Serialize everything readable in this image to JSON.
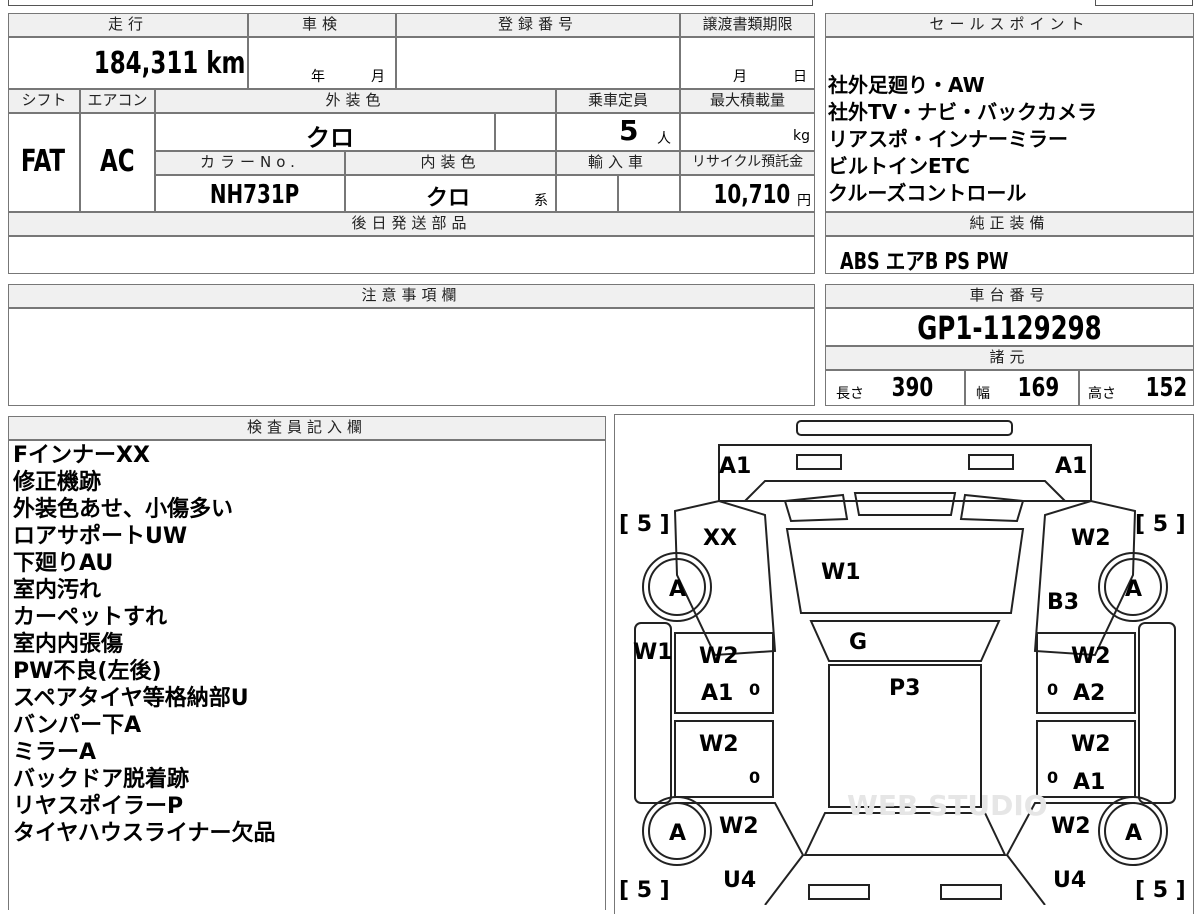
{
  "top": {
    "mileage_header": "走行",
    "mileage_value": "184,311 km",
    "shaken_header": "車検",
    "shaken_year_unit": "年",
    "shaken_month_unit": "月",
    "reg_header": "登録番号",
    "transfer_header": "譲渡書類期限",
    "transfer_month_unit": "月",
    "transfer_day_unit": "日",
    "shift_header": "シフト",
    "shift_value": "FAT",
    "ac_header": "エアコン",
    "ac_value": "AC",
    "ext_color_header": "外装色",
    "ext_color_value": "クロ",
    "capacity_header": "乗車定員",
    "capacity_value": "5",
    "capacity_unit": "人",
    "maxload_header": "最大積載量",
    "maxload_unit": "kg",
    "color_no_header": "カラーNo.",
    "color_no_value": "NH731P",
    "int_color_header": "内装色",
    "int_color_value": "クロ",
    "int_color_suffix": "系",
    "import_header": "輸入車",
    "recycle_header": "リサイクル預託金",
    "recycle_value": "10,710",
    "recycle_unit": "円",
    "later_parts_header": "後日発送部品"
  },
  "selling_points": {
    "header": "セールスポイント",
    "lines": [
      "社外足廻り・AW",
      "社外TV・ナビ・バックカメラ",
      "リアスポ・インナーミラー",
      "ビルトインETC",
      "クルーズコントロール"
    ]
  },
  "genuine_equipment": {
    "header": "純正装備",
    "value": "ABS エアB PS PW"
  },
  "notes": {
    "header": "注意事項欄"
  },
  "chassis": {
    "header": "車台番号",
    "value": "GP1-1129298",
    "spec_header": "諸元",
    "length_label": "長さ",
    "length_value": "390",
    "width_label": "幅",
    "width_value": "169",
    "height_label": "高さ",
    "height_value": "152"
  },
  "inspector": {
    "header": "検査員記入欄",
    "lines": [
      "FインナーXX",
      "修正機跡",
      "外装色あせ、小傷多い",
      "ロアサポートUW",
      "下廻りAU",
      "室内汚れ",
      "カーペットすれ",
      "室内内張傷",
      "PW不良(左後)",
      "スペアタイヤ等格納部U",
      "バンパー下A",
      "ミラーA",
      "バックドア脱着跡",
      "リヤスポイラーP",
      "タイヤハウスライナー欠品"
    ]
  },
  "diagram": {
    "marks": [
      "A1",
      "A1",
      "XX",
      "W1",
      "W2",
      "B3",
      "W1",
      "G",
      "W2",
      "W2",
      "A1",
      "P3",
      "A2",
      "W2",
      "W2",
      "A1",
      "W2",
      "W2",
      "U4",
      "U4"
    ],
    "tires": [
      "A",
      "A",
      "A",
      "A"
    ],
    "tread": [
      "[ 5 ]",
      "[ 5 ]",
      "[ 5 ]",
      "[ 5 ]"
    ],
    "zeros": [
      "0",
      "0",
      "0",
      "0"
    ],
    "watermark": "WEB STUDIO"
  }
}
